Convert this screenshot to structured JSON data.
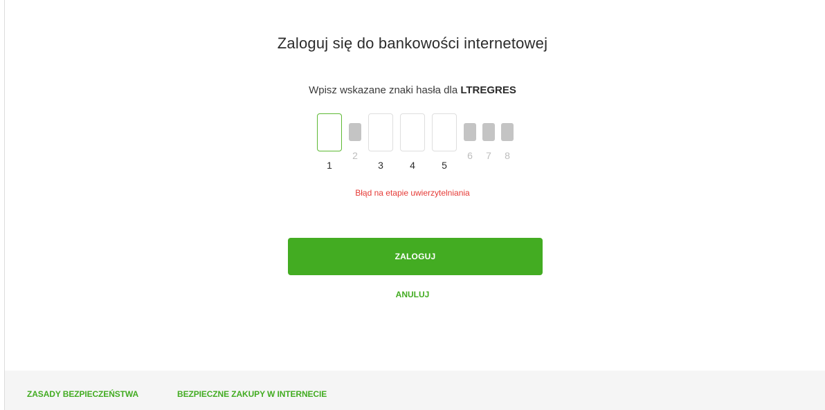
{
  "login": {
    "title": "Zaloguj się do bankowości internetowej",
    "subtitle_prefix": "Wpisz wskazane znaki hasła dla ",
    "username": "LTREGRES",
    "error": "Błąd na etapie uwierzytelniania",
    "login_label": "ZALOGUJ",
    "cancel_label": "ANULUJ"
  },
  "password_chars": [
    {
      "num": "1",
      "state": "active"
    },
    {
      "num": "2",
      "state": "disabled"
    },
    {
      "num": "3",
      "state": "enabled"
    },
    {
      "num": "4",
      "state": "enabled"
    },
    {
      "num": "5",
      "state": "enabled"
    },
    {
      "num": "6",
      "state": "disabled"
    },
    {
      "num": "7",
      "state": "disabled"
    },
    {
      "num": "8",
      "state": "disabled"
    }
  ],
  "footer": {
    "link1": "ZASADY BEZPIECZEŃSTWA",
    "link2": "BEZPIECZNE ZAKUPY W INTERNECIE"
  },
  "colors": {
    "accent": "#43ac22",
    "error": "#e53935",
    "disabled": "#c4c4c4"
  }
}
